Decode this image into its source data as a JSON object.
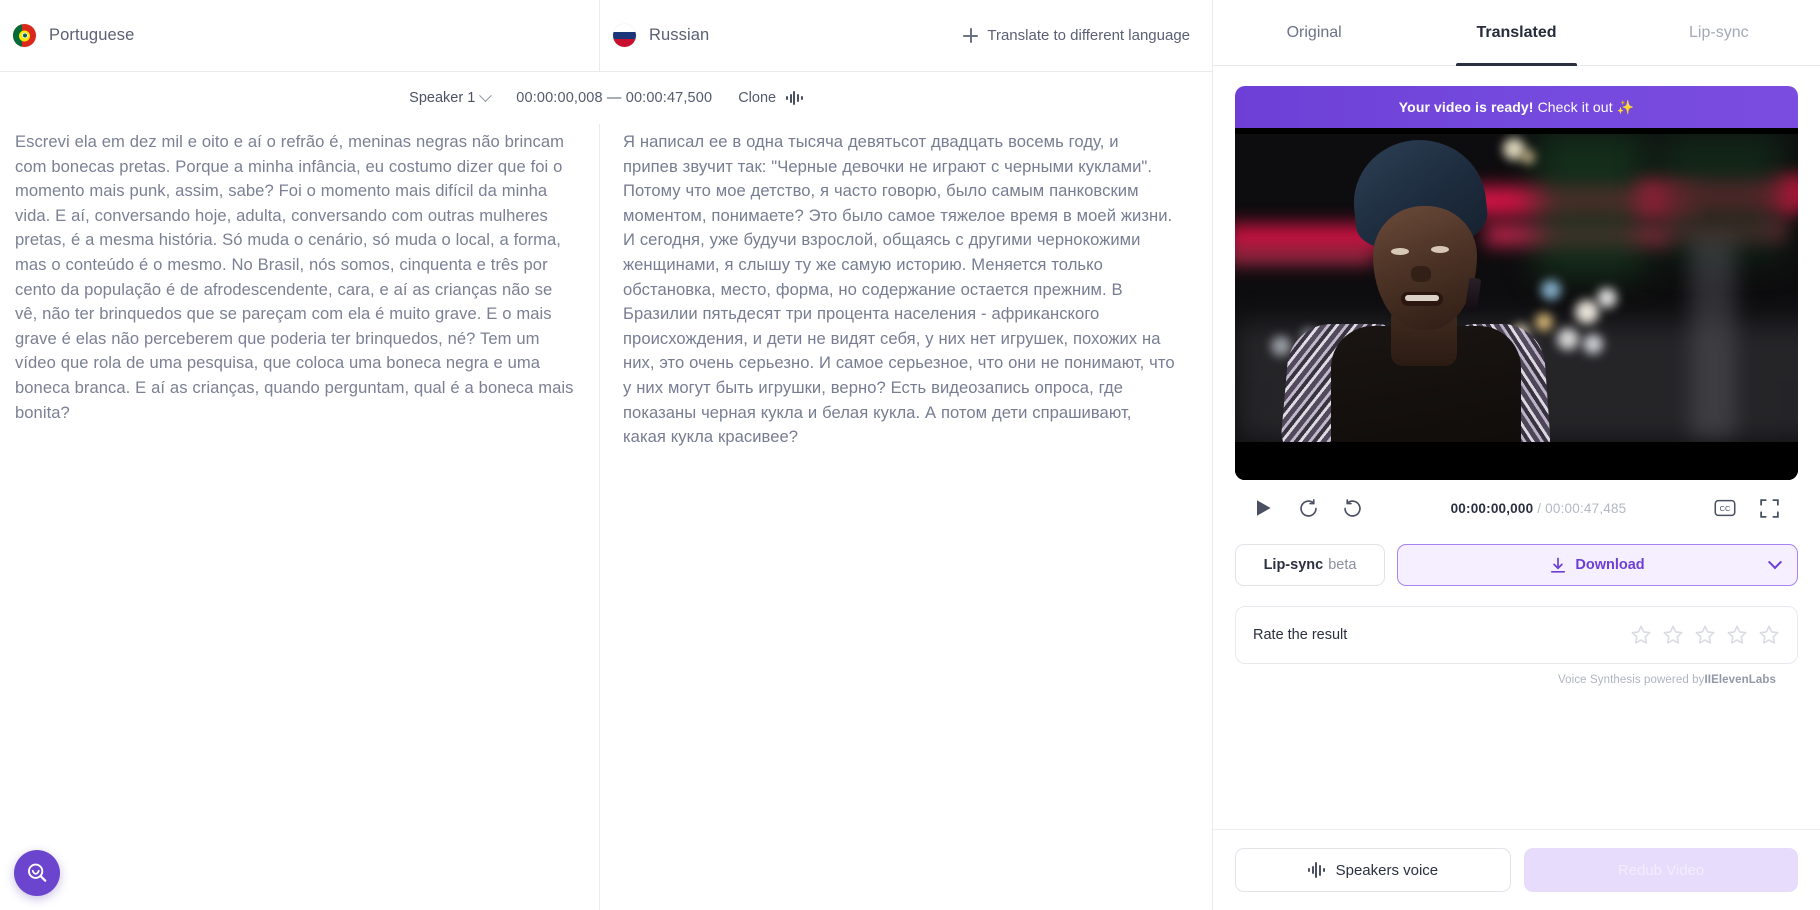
{
  "languages": {
    "source": {
      "name": "Portuguese",
      "flag": "flag-portugal-icon"
    },
    "target": {
      "name": "Russian",
      "flag": "flag-russia-icon"
    },
    "add_label": "Translate to different language"
  },
  "toolbar": {
    "speaker": "Speaker 1",
    "timecode": "00:00:00,008 — 00:00:47,500",
    "clone_label": "Clone"
  },
  "transcript": {
    "source": "Escrevi ela em dez mil e oito e aí o refrão é, meninas negras não brincam com bonecas pretas. Porque a minha infância, eu costumo dizer que foi o momento mais punk, assim, sabe? Foi o momento mais difícil da minha vida. E aí, conversando hoje, adulta, conversando com outras mulheres pretas, é a mesma história. Só muda o cenário, só muda o local, a forma, mas o conteúdo é o mesmo. No Brasil, nós somos, cinquenta e três por cento da população é de afrodescendente, cara, e aí as crianças não se vê, não ter brinquedos que se pareçam com ela é muito grave. E o mais grave é elas não perceberem que poderia ter brinquedos, né? Tem um vídeo que rola de uma pesquisa, que coloca uma boneca negra e uma boneca branca. E aí as crianças, quando perguntam, qual é a boneca mais bonita?",
    "target": "Я написал ее в одна тысяча девятьсот двадцать восемь году, и припев звучит так: \"Черные девочки не играют с черными куклами\". Потому что мое детство, я часто говорю, было самым панковским моментом, понимаете? Это было самое тяжелое время в моей жизни. И сегодня, уже будучи взрослой, общаясь с другими чернокожими женщинами, я слышу ту же самую историю. Меняется только обстановка, место, форма, но содержание остается прежним. В Бразилии пятьдесят три процента населения - африканского происхождения, и дети не видят себя, у них нет игрушек, похожих на них, это очень серьезно. И самое серьезное, что они не понимают, что у них могут быть игрушки, верно? Есть видеозапись опроса, где показаны черная кукла и белая кукла. А потом дети спрашивают, какая кукла красивее?"
  },
  "panel": {
    "tabs": [
      {
        "label": "Original",
        "active": false,
        "muted": false
      },
      {
        "label": "Translated",
        "active": true,
        "muted": false
      },
      {
        "label": "Lip-sync",
        "active": false,
        "muted": true
      }
    ],
    "banner": {
      "strong": "Your video is ready!",
      "rest": "Check it out ✨"
    },
    "player": {
      "current_time": "00:00:00,000",
      "total_time": "/ 00:00:47,485",
      "play_icon": "play-icon",
      "rewind_icon": "rewind-10-icon",
      "forward_icon": "forward-10-icon",
      "cc_icon": "closed-captions-icon",
      "fullscreen_icon": "fullscreen-icon"
    },
    "buttons": {
      "lipsync": "Lip-sync",
      "lipsync_beta": "beta",
      "download": "Download"
    },
    "rate": {
      "label": "Rate the result",
      "stars": 5,
      "filled": 0
    },
    "powered": {
      "prefix": "Voice Synthesis powered by",
      "brand": "IIElevenLabs"
    },
    "footer": {
      "speakers_voice": "Speakers voice",
      "redub": "Redub Video"
    }
  },
  "fab": {
    "icon": "search-help-icon"
  },
  "colors": {
    "accent_purple": "#6d3fd6",
    "fab_purple": "#6c45cf",
    "download_bg": "#f5efff",
    "redub_bg": "#e7dcfb",
    "text_muted": "#7b8094",
    "tab_active": "#2a2f3f"
  }
}
